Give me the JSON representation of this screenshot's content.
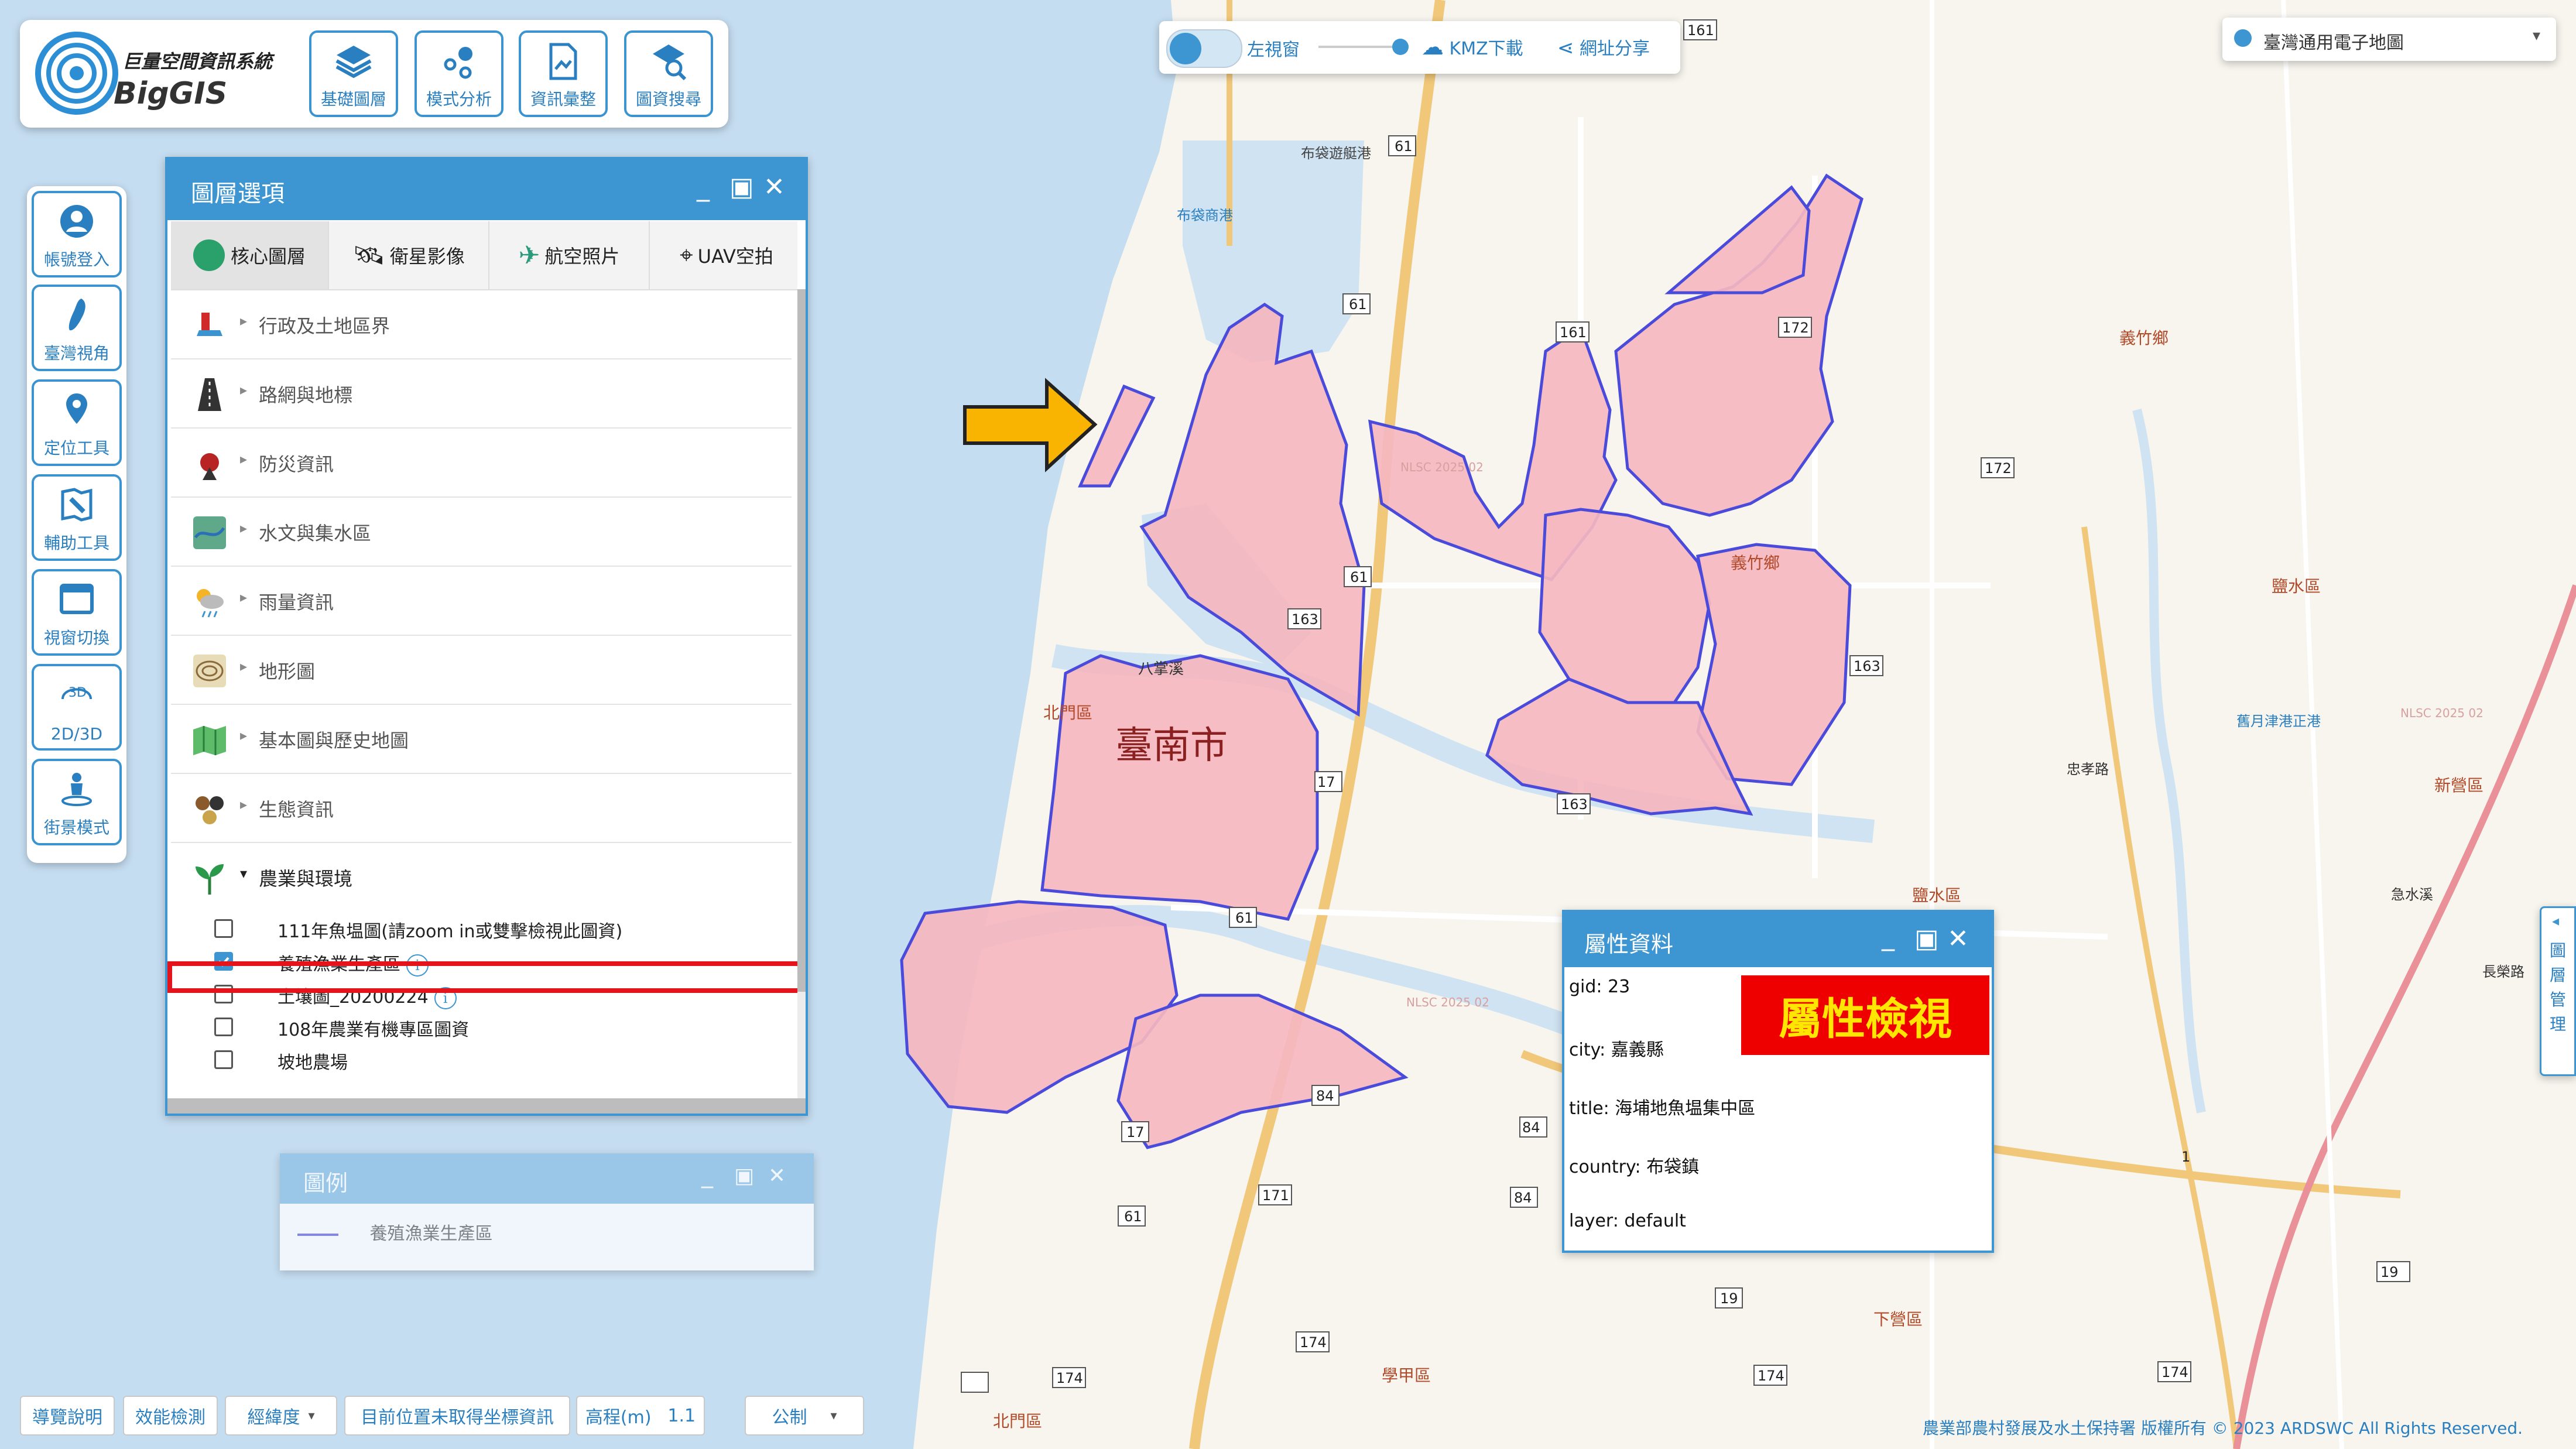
{
  "app": {
    "logo_title": "巨量空間資訊系統",
    "logo_name": "BigGIS"
  },
  "toolbar": [
    {
      "label": "基礎圖層",
      "icon": "layers-icon"
    },
    {
      "label": "模式分析",
      "icon": "analysis-icon"
    },
    {
      "label": "資訊彙整",
      "icon": "document-icon"
    },
    {
      "label": "圖資搜尋",
      "icon": "search-icon"
    }
  ],
  "sidebar": [
    {
      "label": "帳號登入",
      "icon": "user-icon"
    },
    {
      "label": "臺灣視角",
      "icon": "taiwan-icon"
    },
    {
      "label": "定位工具",
      "icon": "location-pin-icon"
    },
    {
      "label": "輔助工具",
      "icon": "tools-icon"
    },
    {
      "label": "視窗切換",
      "icon": "window-icon"
    },
    {
      "label": "2D/3D",
      "icon": "3d-icon"
    },
    {
      "label": "街景模式",
      "icon": "street-view-icon"
    }
  ],
  "top_controls": {
    "left_view_label": "左視窗",
    "kmz_label": "KMZ下載",
    "share_label": "網址分享",
    "basemap_value": "臺灣通用電子地圖"
  },
  "layer_panel": {
    "title": "圖層選項",
    "tabs": [
      "核心圖層",
      "衛星影像",
      "航空照片",
      "UAV空拍"
    ],
    "categories": [
      "行政及土地區界",
      "路網與地標",
      "防災資訊",
      "水文與集水區",
      "雨量資訊",
      "地形圖",
      "基本圖與歷史地圖",
      "生態資訊",
      "農業與環境"
    ],
    "sub_layers": [
      {
        "label": "111年魚塭圖(請zoom in或雙擊檢視此圖資)",
        "checked": false
      },
      {
        "label": "養殖漁業生產區",
        "checked": true
      },
      {
        "label": "土壤圖_20200224",
        "checked": false
      },
      {
        "label": "108年農業有機專區圖資",
        "checked": false
      },
      {
        "label": "坡地農場",
        "checked": false
      }
    ]
  },
  "legend": {
    "title": "圖例",
    "item": "養殖漁業生產區"
  },
  "attribute_panel": {
    "title": "屬性資料",
    "badge": "屬性檢視",
    "rows": [
      "gid: 23",
      "city: 嘉義縣",
      "title: 海埔地魚塭集中區",
      "country: 布袋鎮",
      "layer: default"
    ]
  },
  "right_tab": "圖層管理",
  "map": {
    "city_label": "臺南市",
    "places": [
      "布袋遊艇港",
      "布袋商港",
      "八掌溪",
      "北門區",
      "義竹鄉",
      "義竹鄉",
      "鹽水區",
      "鹽水區",
      "新營區",
      "下營區",
      "學甲區",
      "北門區",
      "忠孝路",
      "急水溪",
      "長榮路",
      "舊月津港正港",
      "NLSC 2025 02",
      "NLSC 2025 02",
      "NLSC 2025 02"
    ],
    "roads": [
      "61",
      "61",
      "61",
      "61",
      "61",
      "163",
      "163",
      "163",
      "161",
      "161",
      "172",
      "172",
      "171",
      "174",
      "174",
      "174",
      "174",
      "17",
      "17",
      "19",
      "19",
      "84",
      "84",
      "84",
      "1"
    ]
  },
  "bottom_bar": {
    "guide": "導覽說明",
    "perf": "效能檢測",
    "coord_type": "經緯度",
    "position": "目前位置未取得坐標資訊",
    "elevation": "高程(m)",
    "elevation_value": "1.1",
    "unit": "公制",
    "copyright": "農業部農村發展及水土保持署 版權所有 © 2023 ARDSWC All Rights Reserved."
  },
  "colors": {
    "accent": "#3d96d1",
    "polygon_fill": "#f5b7c0",
    "polygon_stroke": "#4a4adb",
    "highlight_red": "#e3141c",
    "arrow_yellow": "#f8b400"
  }
}
